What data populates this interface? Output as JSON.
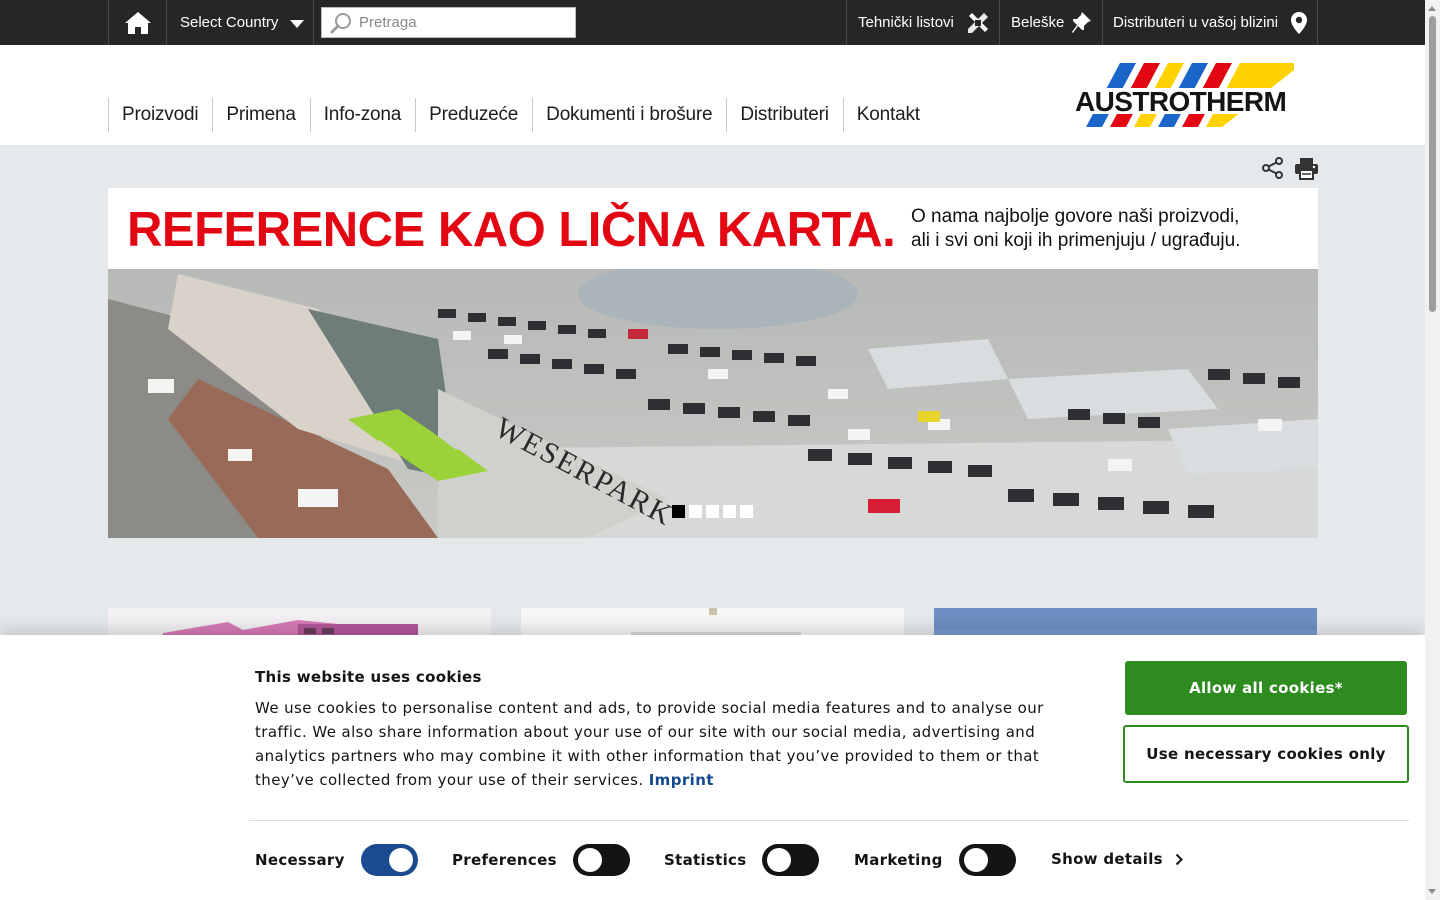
{
  "topbar": {
    "country_label": "Select Country",
    "search_placeholder": "Pretraga",
    "tech_sheets": "Tehnički listovi",
    "notes": "Beleške",
    "distributors_near": "Distributeri u vašoj blizini"
  },
  "nav": {
    "items": [
      "Proizvodi",
      "Primena",
      "Info-zona",
      "Preduzeće",
      "Dokumenti i brošure",
      "Distributeri",
      "Kontakt"
    ]
  },
  "logo": {
    "text": "AUSTROTHERM",
    "colors": [
      "#1a66c8",
      "#e30613",
      "#ffd200"
    ]
  },
  "banner": {
    "title": "REFERENCE KAO LIČNA KARTA.",
    "subtitle_line1": "O nama najbolje govore naši proizvodi,",
    "subtitle_line2": "ali i svi oni koji ih primenjuju / ugrađuju.",
    "image_sign": "WESERPARK",
    "slides": 5,
    "active_slide": 1
  },
  "cookie": {
    "title": "This website uses cookies",
    "text": "We use cookies to personalise content and ads, to provide social media features and to analyse our traffic. We also share information about your use of our site with our social media, advertising and analytics partners who may combine it with other information that you’ve provided to them or that they’ve collected from your use of their services.",
    "imprint": "Imprint",
    "allow_all": "Allow all cookies*",
    "necessary_only": "Use necessary cookies only",
    "options": {
      "necessary": "Necessary",
      "preferences": "Preferences",
      "statistics": "Statistics",
      "marketing": "Marketing"
    },
    "show_details": "Show details"
  },
  "colors": {
    "topbar_bg": "#262626",
    "brand_red": "#e30613",
    "accept_green": "#2e8b1f",
    "toggle_on": "#1a4a8f",
    "page_bg": "#e5e9ec"
  }
}
